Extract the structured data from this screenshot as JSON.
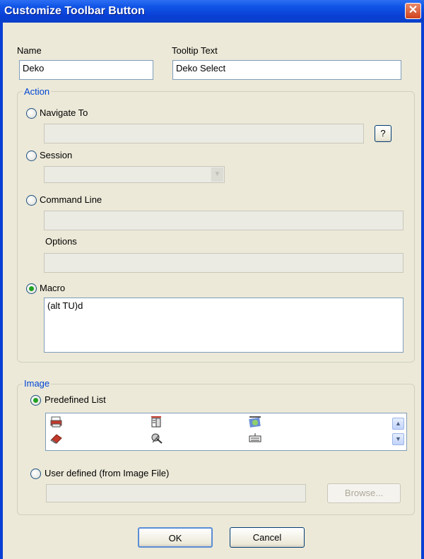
{
  "window": {
    "title": "Customize Toolbar Button",
    "close_glyph": "✕"
  },
  "name_field": {
    "label": "Name",
    "value": "Deko"
  },
  "tooltip_field": {
    "label": "Tooltip Text",
    "value": "Deko Select"
  },
  "action": {
    "legend": "Action",
    "navigate_to": {
      "label": "Navigate To",
      "value": "",
      "help_label": "?"
    },
    "session": {
      "label": "Session",
      "value": ""
    },
    "command_line": {
      "label": "Command Line",
      "value": ""
    },
    "options": {
      "label": "Options",
      "value": ""
    },
    "macro": {
      "label": "Macro",
      "value": "(alt TU)d",
      "selected": true
    }
  },
  "image": {
    "legend": "Image",
    "predefined_list": {
      "label": "Predefined List",
      "selected": true,
      "icons": [
        "printer-icon",
        "book-icon",
        "globe-icon",
        "eraser-icon",
        "satellite-icon",
        "keyboard-icon"
      ]
    },
    "user_defined": {
      "label": "User defined (from Image File)",
      "value": "",
      "browse_label": "Browse..."
    }
  },
  "buttons": {
    "ok_label": "OK",
    "cancel_label": "Cancel"
  },
  "colors": {
    "title_bar": "#0a3fd6",
    "dialog_bg": "#ece9d8",
    "legend_text": "#0046d5",
    "radio_dot": "#21a121"
  }
}
